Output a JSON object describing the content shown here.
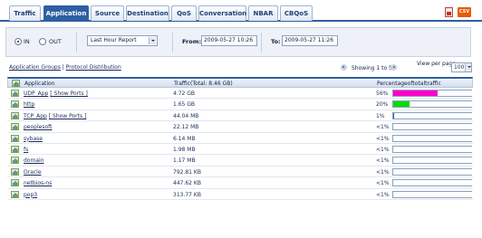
{
  "tabs": [
    {
      "label": "Traffic",
      "active": false
    },
    {
      "label": "Application",
      "active": true
    },
    {
      "label": "Source",
      "active": false
    },
    {
      "label": "Destination",
      "active": false
    },
    {
      "label": "QoS",
      "active": false
    },
    {
      "label": "Conversation",
      "active": false
    },
    {
      "label": "NBAR",
      "active": false
    },
    {
      "label": "CBQoS",
      "active": false
    }
  ],
  "export": {
    "csv_label": "CSV"
  },
  "filter": {
    "in_label": "IN",
    "out_label": "OUT",
    "direction_selected": "IN",
    "report_select": "Last Hour Report",
    "from_label": "From:",
    "from_value": "2009-05-27 10:26",
    "to_label": "To:",
    "to_value": "2009-05-27 11:26"
  },
  "links": {
    "groups": "Application Groups",
    "divider": " | ",
    "protocol": "Protocol Distribution"
  },
  "pager": {
    "showing": "Showing 1 to 57",
    "per_page_label": "View per page",
    "per_page_value": "100"
  },
  "table": {
    "headers": {
      "application": "Application",
      "traffic": "Traffic(Total: 8.46 GB)",
      "percentage": "Percentageoftotaltraffic"
    },
    "rows": [
      {
        "name": "UDP_App",
        "show_ports": "[ Show Ports ]",
        "traffic": "4.72 GB",
        "pct": "56%",
        "fill": 0.56,
        "color": "#ff00cc"
      },
      {
        "name": "http",
        "show_ports": "",
        "traffic": "1.65 GB",
        "pct": "20%",
        "fill": 0.2,
        "color": "#00dd00"
      },
      {
        "name": "TCP_App",
        "show_ports": "[ Show Ports ]",
        "traffic": "44.04 MB",
        "pct": "1%",
        "fill": 0.01,
        "color": "#2e5fa3"
      },
      {
        "name": "peoplesoft",
        "show_ports": "",
        "traffic": "22.12 MB",
        "pct": "<1%",
        "fill": 0.0,
        "color": "#2e5fa3"
      },
      {
        "name": "sybase",
        "show_ports": "",
        "traffic": "6.14 MB",
        "pct": "<1%",
        "fill": 0.0,
        "color": "#2e5fa3"
      },
      {
        "name": "fs",
        "show_ports": "",
        "traffic": "1.98 MB",
        "pct": "<1%",
        "fill": 0.0,
        "color": "#2e5fa3"
      },
      {
        "name": "domain",
        "show_ports": "",
        "traffic": "1.17 MB",
        "pct": "<1%",
        "fill": 0.0,
        "color": "#2e5fa3"
      },
      {
        "name": "Oracle",
        "show_ports": "",
        "traffic": "792.81 KB",
        "pct": "<1%",
        "fill": 0.0,
        "color": "#2e5fa3"
      },
      {
        "name": "netbios-ns",
        "show_ports": "",
        "traffic": "447.62 KB",
        "pct": "<1%",
        "fill": 0.0,
        "color": "#2e5fa3"
      },
      {
        "name": "pop3",
        "show_ports": "",
        "traffic": "313.77 KB",
        "pct": "<1%",
        "fill": 0.0,
        "color": "#2e5fa3"
      }
    ]
  },
  "colors": {
    "accent": "#2e5fa3",
    "header_text": "#1a2b5a"
  }
}
